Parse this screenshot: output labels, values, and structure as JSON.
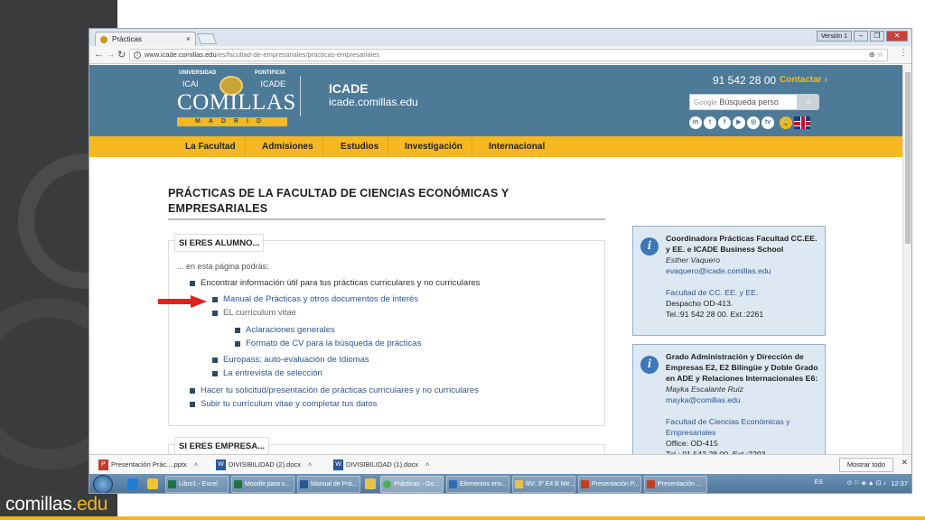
{
  "slide": {
    "brand_name": "comillas.",
    "brand_suffix": "edu"
  },
  "browser": {
    "tab_title": "Prácticas",
    "tab_close": "×",
    "window_label": "Versión 1",
    "url_host": "www.icade.comillas.edu",
    "url_path": "/es/facultad-de-empresariales/practicas-empresariales"
  },
  "site": {
    "logo_top_left": "UNIVERSIDAD",
    "logo_top_right": "PONTIFICIA",
    "logo_icai": "ICAI",
    "logo_icade": "ICADE",
    "logo_name": "COMILLAS",
    "logo_city": "MADRID",
    "title": "ICADE",
    "subtitle": "icade.comillas.edu",
    "phone": "91 542 28 00",
    "contact": "Contactar ›",
    "search_google": "Google",
    "search_placeholder": "Búsqueda perso",
    "socials": [
      "in",
      "t",
      "f",
      "▶",
      "◎",
      "tv"
    ],
    "nav": [
      "La Facultad",
      "Admisiones",
      "Estudios",
      "Investigación",
      "Internacional"
    ]
  },
  "main": {
    "heading": "PRÁCTICAS DE LA FACULTAD DE CIENCIAS ECONÓMICAS Y EMPRESARIALES",
    "alumno_title": "SI ERES ALUMNO...",
    "intro": "... en esta página podrás:",
    "items": [
      "Encontrar información útil para tus prácticas curriculares y no curriculares",
      "Manual de Prácticas y otros documentos de interés",
      "EL currículum vitae",
      "Aclaraciones generales",
      "Formato de CV para la búsqueda de prácticas",
      "Europass: auto-evaluación de Idiomas",
      "La entrevista de selección",
      "Hacer tu solicitud/presentación de prácticas curriculares y no curriculares",
      "Subir tu currículum vitae y completar tus datos"
    ],
    "empresa_title": "SI ERES EMPRESA..."
  },
  "sidebar": {
    "box1": {
      "title": "Coordinadora Prácticas Facultad CC.EE. y EE. e ICADE Business School",
      "person": "Esther Vaquero",
      "email": "evaquero@icade.comillas.edu",
      "dept": "Facultad de CC. EE. y EE.",
      "office": "Despacho OD-413.",
      "tel": "Tel.:91 542 28 00. Ext.:2261"
    },
    "box2": {
      "title": "Grado Administración y Dirección de Empresas E2, E2 Bilingüe y Doble Grado en ADE y Relaciones Internacionales E6:",
      "person": "Mayka Escalante Ruiz",
      "email": "mayka@comillas.edu",
      "dept": "Facultad de Ciencias Económicas y Empresariales",
      "office": "Office: OD-415",
      "tel": "Tel.: 91 542 28 00. Ext.:2293"
    }
  },
  "downloads": {
    "items": [
      "Presentación Prác....pptx",
      "DIVISIBILIDAD (2).docx",
      "DIVISIBILIDAD (1).docx"
    ],
    "show_all": "Mostrar todo"
  },
  "taskbar": {
    "tasks": [
      "Libro1 - Excel",
      "Moodle para v...",
      "Manual de Prá...",
      "Prácticas - Go...",
      "Elementos env...",
      "RV: 3º E4 B Me...",
      "Presentación P...",
      "Presentación ..."
    ],
    "lang": "ES",
    "time": "12:37"
  }
}
